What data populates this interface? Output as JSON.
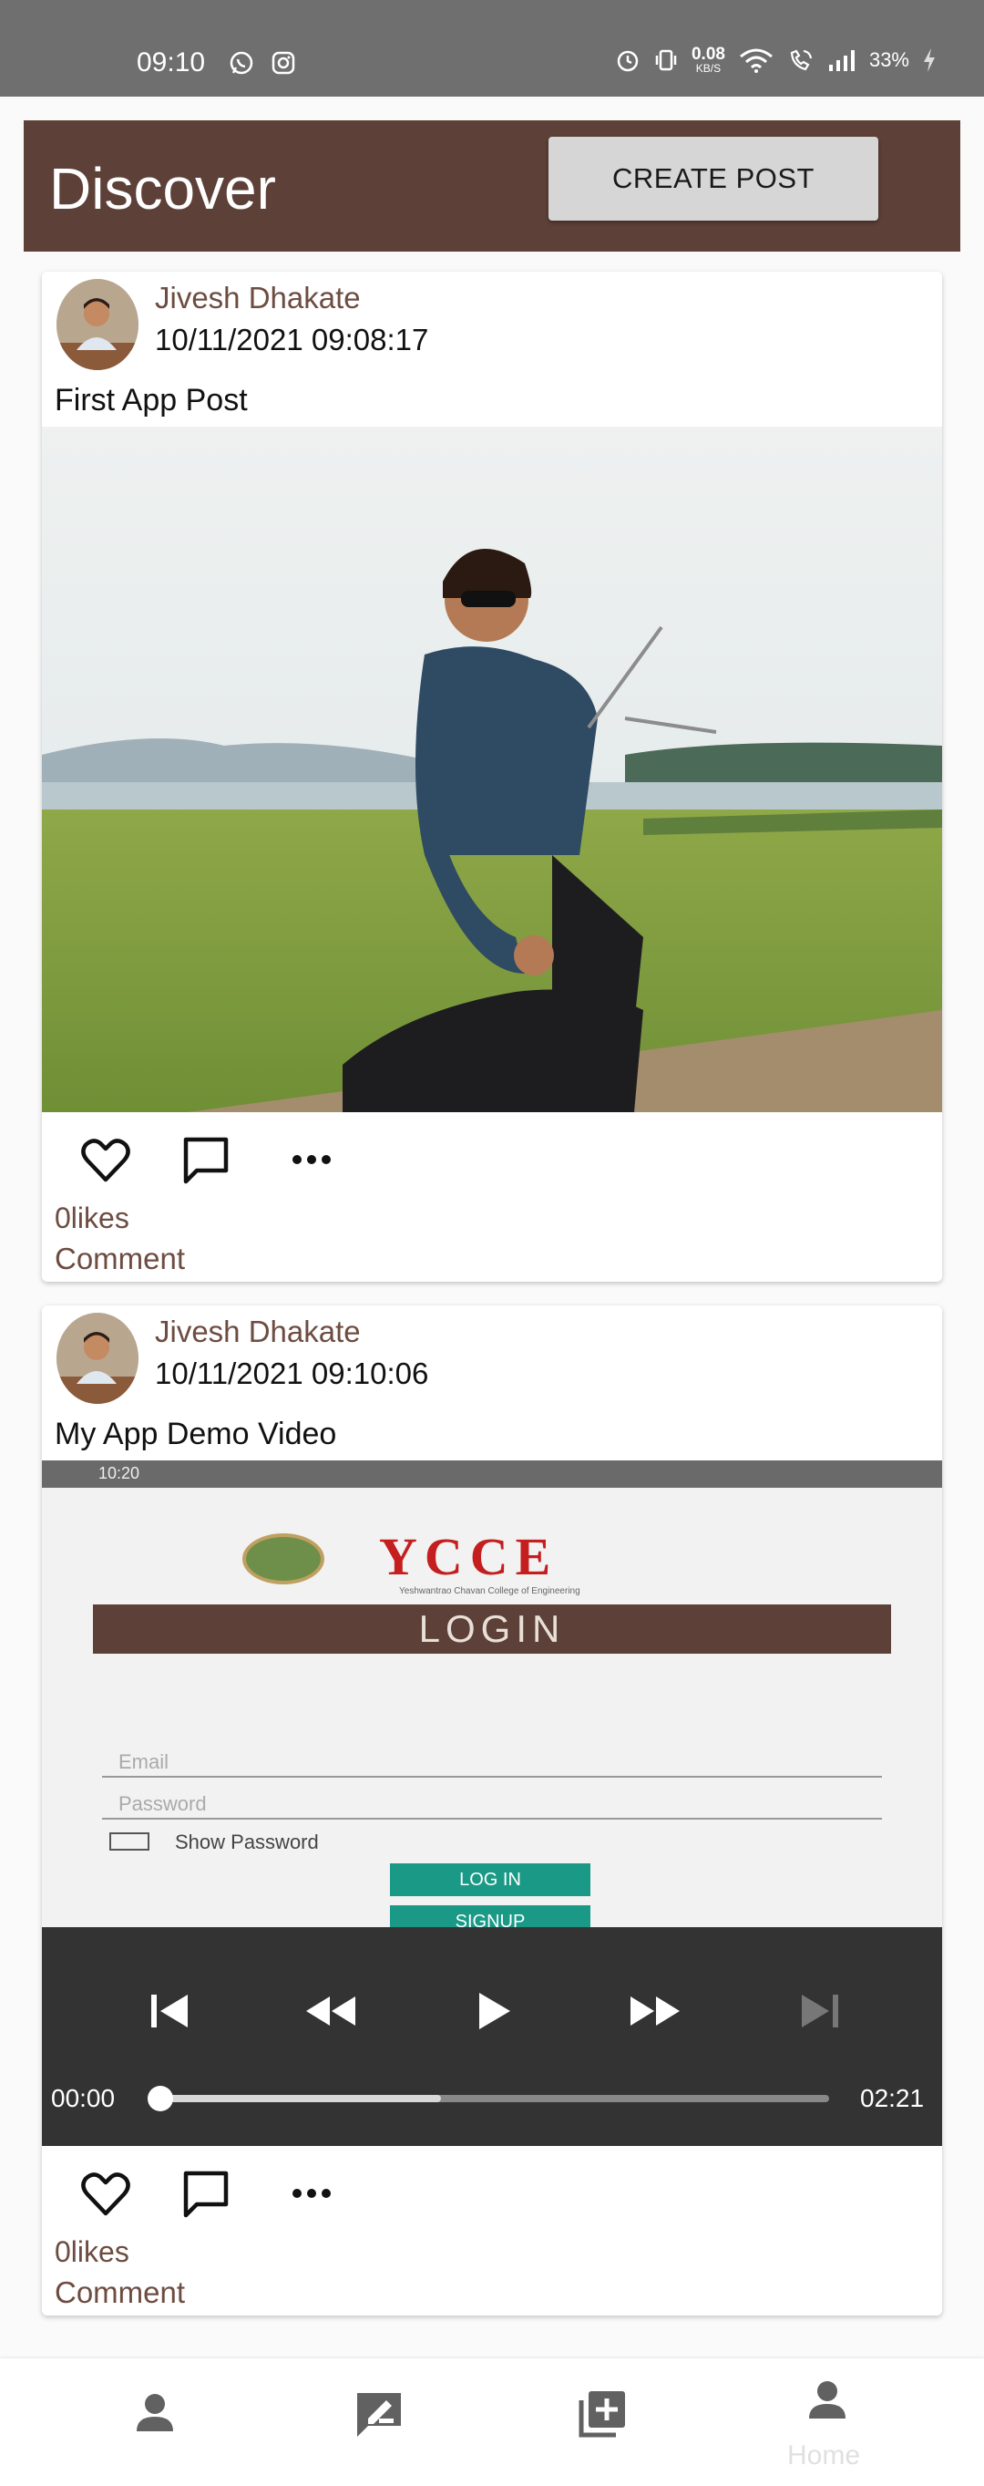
{
  "status_bar": {
    "time": "09:10",
    "net_speed_value": "0.08",
    "net_speed_unit": "KB/S",
    "battery": "33%"
  },
  "header": {
    "title": "Discover",
    "create_post_label": "CREATE POST"
  },
  "posts": [
    {
      "author": "Jivesh Dhakate",
      "timestamp": "10/11/2021  09:08:17",
      "caption": "First App Post",
      "likes": "0likes",
      "comment_label": "Comment"
    },
    {
      "author": "Jivesh Dhakate",
      "timestamp": "10/11/2021  09:10:06",
      "caption": "My App Demo Video",
      "likes": "0likes",
      "comment_label": "Comment",
      "video": {
        "current_time": "00:00",
        "duration": "02:21",
        "buffered_fraction": 0.42,
        "preview": {
          "status_time": "10:20",
          "brand": "YCCE",
          "brand_subtitle": "Yeshwantrao Chavan College of Engineering",
          "login_banner": "LOGIN",
          "email_placeholder": "Email",
          "password_placeholder": "Password",
          "show_password": "Show Password",
          "login_button": "LOG IN",
          "signup_button": "SIGNUP"
        }
      }
    }
  ],
  "bottom_nav": {
    "active_label": "Home"
  },
  "colors": {
    "brand": "#5d4037",
    "accent_text": "#6d4c41",
    "status_bar": "#6f6f6f",
    "video_controls": "#333333",
    "preview_button": "#1a9a86"
  }
}
